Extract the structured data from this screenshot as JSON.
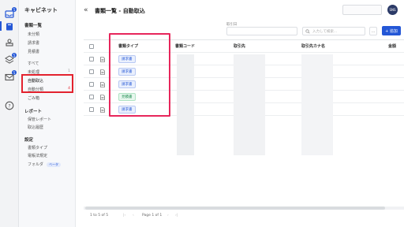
{
  "rail": {
    "icons": [
      "inbox-icon",
      "book-icon",
      "stamp-icon",
      "layers-icon",
      "mail-icon",
      "help-icon"
    ],
    "badges": [
      "5",
      "5",
      "5"
    ]
  },
  "nav": {
    "title": "キャビネット",
    "section_docs": "書類一覧",
    "items_docs": [
      "未分類",
      "請求書",
      "見積書"
    ],
    "items_status": [
      "すべて",
      "未処理",
      "自動取込",
      "自動分類",
      "ごみ箱"
    ],
    "section_report": "レポート",
    "items_report": [
      "保管レポート",
      "取込履歴"
    ],
    "section_settings": "設定",
    "items_settings": [
      "書類タイプ",
      "電帳法規定",
      "フォルダ"
    ],
    "beta_label": "ベータ",
    "count_status_1": "1",
    "count_auto_classify": "4"
  },
  "header": {
    "collapse_icon": "«",
    "title": "書類一覧 - 自動取込",
    "avatar_label": "SNS"
  },
  "filters": {
    "date_label": "取引日",
    "search_placeholder": "入力して検索...",
    "more_label": "...",
    "add_label": "+ 追加"
  },
  "table": {
    "columns": [
      "書類タイプ",
      "書類コード",
      "取引先",
      "取引先カナ名",
      "金額"
    ],
    "rows": [
      {
        "type": "請求書",
        "type_color": "blue"
      },
      {
        "type": "請求書",
        "type_color": "blue"
      },
      {
        "type": "請求書",
        "type_color": "blue"
      },
      {
        "type": "見積書",
        "type_color": "green"
      },
      {
        "type": "請求書",
        "type_color": "blue"
      }
    ]
  },
  "pager": {
    "range": "1 to 5 of 5",
    "page": "Page 1 of 1"
  },
  "colors": {
    "accent": "#2457d6",
    "highlight": "#e3222e"
  }
}
